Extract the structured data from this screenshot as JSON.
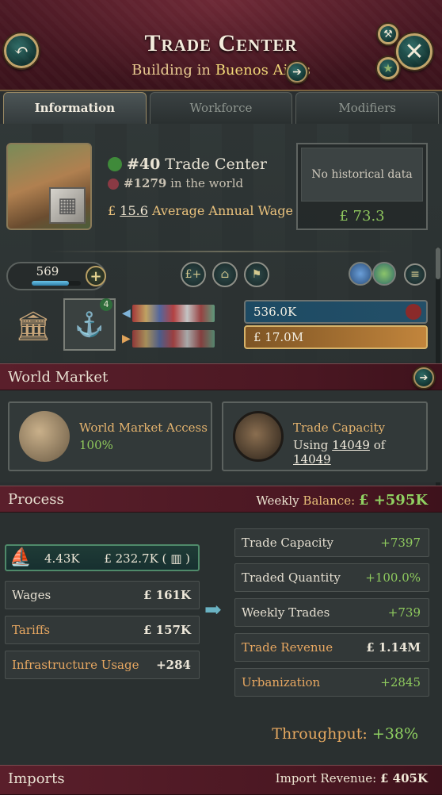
{
  "header": {
    "title": "Trade Center",
    "subtitle_prefix": "Building in",
    "city": "Buenos Aires"
  },
  "tabs": [
    {
      "label": "Information",
      "active": true
    },
    {
      "label": "Workforce",
      "active": false
    },
    {
      "label": "Modifiers",
      "active": false
    }
  ],
  "info": {
    "rank_country": "#40",
    "rank_country_label": "Trade Center",
    "rank_world": "#1279",
    "rank_world_label": "in the world",
    "wage_symbol": "£",
    "wage_value": "15.6",
    "wage_label": "Average Annual Wage",
    "history_text": "No historical data",
    "history_value": "£ 73.3"
  },
  "level": {
    "value": "569",
    "fill_fraction": 0.75
  },
  "production": {
    "pm_count": "4",
    "employment": "536.0K",
    "cash": "£ 17.0M"
  },
  "world_market": {
    "label": "World Market",
    "access_title": "World Market Access",
    "access_value": "100%",
    "capacity_title": "Trade Capacity",
    "capacity_using": "Using",
    "capacity_used": "14049",
    "capacity_of": "of",
    "capacity_total": "14049"
  },
  "process": {
    "label": "Process",
    "weekly_label": "Weekly",
    "balance_label": "Balance:",
    "balance_value": "£ +595K",
    "output_qty": "4.43K",
    "output_value": "£ 232.7K (",
    "output_suffix": ")",
    "left_rows": [
      {
        "label": "Wages",
        "value": "£ 161K",
        "orange": false
      },
      {
        "label": "Tariffs",
        "value": "£ 157K",
        "orange": true
      },
      {
        "label": "Infrastructure Usage",
        "value": "+284",
        "orange": true
      }
    ],
    "right_rows": [
      {
        "label": "Trade Capacity",
        "value": "+7397",
        "orange": false,
        "green": true
      },
      {
        "label": "Traded Quantity",
        "value": "+100.0%",
        "orange": false,
        "green": true
      },
      {
        "label": "Weekly Trades",
        "value": "+739",
        "orange": false,
        "green": true
      },
      {
        "label": "Trade Revenue",
        "value": "£ 1.14M",
        "orange": true,
        "green": false
      },
      {
        "label": "Urbanization",
        "value": "+2845",
        "orange": true,
        "green": true
      }
    ],
    "throughput_label": "Throughput:",
    "throughput_value": "+38%"
  },
  "imports": {
    "label": "Imports",
    "revenue_label": "Import Revenue:",
    "revenue_value": "£ 405K"
  },
  "colors": {
    "accent_gold": "#e7c98f",
    "positive": "#8fd061",
    "header_red": "#4d1a25"
  }
}
